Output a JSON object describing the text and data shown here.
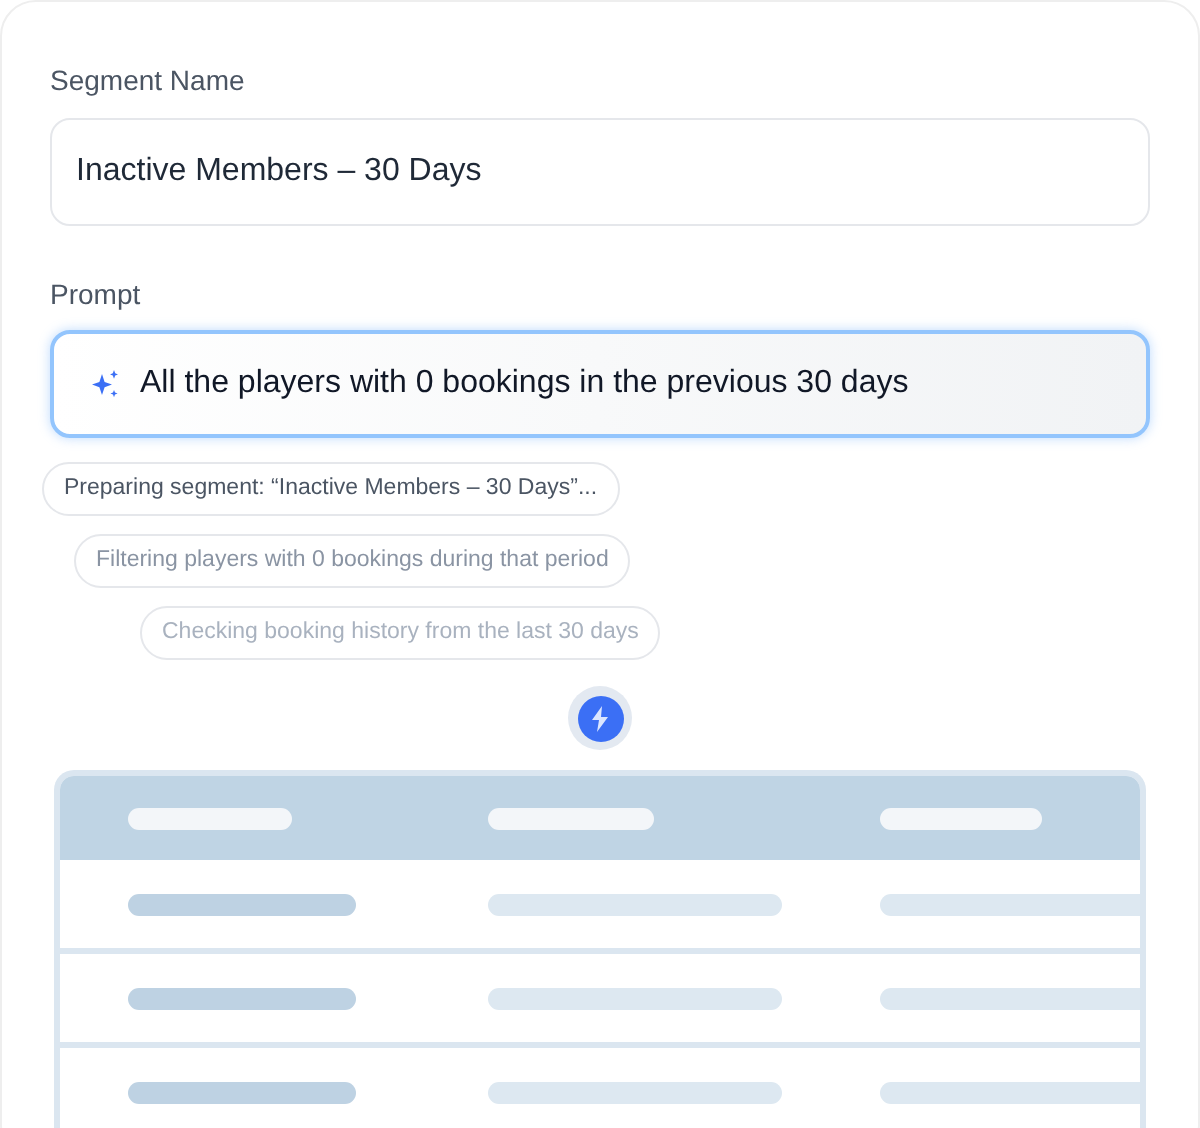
{
  "segment_name": {
    "label": "Segment Name",
    "value": "Inactive Members – 30 Days"
  },
  "prompt": {
    "label": "Prompt",
    "value": "All the players with 0 bookings in the previous 30 days",
    "focused": true
  },
  "steps": [
    {
      "text": "Preparing segment: “Inactive Members – 30 Days”...",
      "kind": "active"
    },
    {
      "text": "Filtering players with 0 bookings during that period",
      "kind": "next"
    },
    {
      "text": "Checking booking history from the last 30 days",
      "kind": "later"
    }
  ]
}
